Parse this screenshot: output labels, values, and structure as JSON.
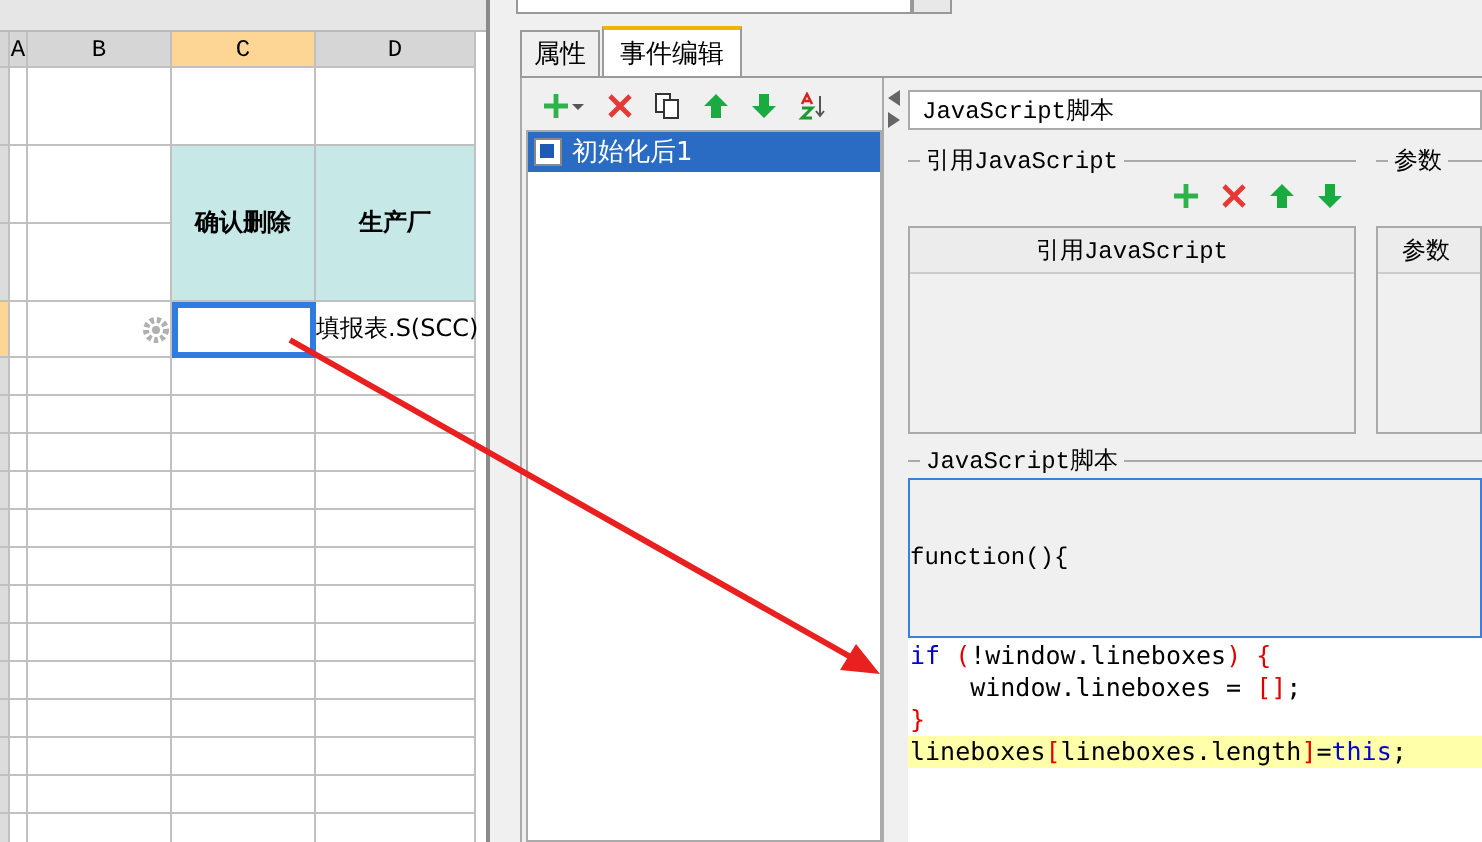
{
  "spreadsheet": {
    "columns": [
      {
        "label": "A",
        "selected": false
      },
      {
        "label": "B",
        "selected": false
      },
      {
        "label": "C",
        "selected": true
      },
      {
        "label": "D",
        "selected": false
      }
    ],
    "header_cells": [
      "确认删除",
      "生产厂"
    ],
    "data_row": {
      "selected": true,
      "column_d": "填报表.S(SCC)"
    }
  },
  "tabs": [
    {
      "label": "属性",
      "selected": false
    },
    {
      "label": "事件编辑",
      "selected": true
    }
  ],
  "events": [
    {
      "label": "初始化后1",
      "selected": true
    }
  ],
  "script_type": "JavaScript脚本",
  "references_group": {
    "title": "引用JavaScript",
    "column": "引用JavaScript"
  },
  "params_group": {
    "title": "参数",
    "column": "参数"
  },
  "script_group": {
    "title": "JavaScript脚本",
    "header": "function(){",
    "code": [
      {
        "highlighted": false,
        "tokens": [
          {
            "text": "if",
            "kind": "keyword"
          },
          {
            "text": " (",
            "kind": "bracket"
          },
          {
            "text": "!window.lineboxes",
            "kind": "plain"
          },
          {
            "text": ") {",
            "kind": "bracket"
          }
        ]
      },
      {
        "highlighted": false,
        "tokens": [
          {
            "text": "    window.lineboxes = ",
            "kind": "plain"
          },
          {
            "text": "[]",
            "kind": "bracket"
          },
          {
            "text": ";",
            "kind": "plain"
          }
        ]
      },
      {
        "highlighted": false,
        "tokens": [
          {
            "text": "}",
            "kind": "bracket"
          }
        ]
      },
      {
        "highlighted": true,
        "tokens": [
          {
            "text": "lineboxes",
            "kind": "plain"
          },
          {
            "text": "[",
            "kind": "bracket"
          },
          {
            "text": "lineboxes.length",
            "kind": "plain"
          },
          {
            "text": "]",
            "kind": "bracket"
          },
          {
            "text": "=",
            "kind": "plain"
          },
          {
            "text": "this",
            "kind": "keyword"
          },
          {
            "text": ";",
            "kind": "plain"
          }
        ]
      }
    ]
  }
}
